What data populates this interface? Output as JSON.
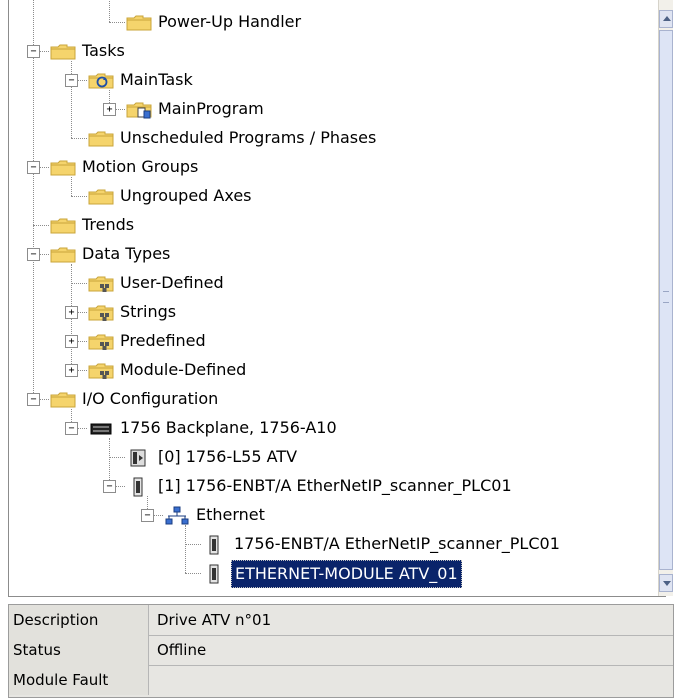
{
  "tree": {
    "items": [
      {
        "label": "Power-Up Handler"
      },
      {
        "label": "Tasks"
      },
      {
        "label": "MainTask"
      },
      {
        "label": "MainProgram"
      },
      {
        "label": "Unscheduled Programs / Phases"
      },
      {
        "label": "Motion Groups"
      },
      {
        "label": "Ungrouped Axes"
      },
      {
        "label": "Trends"
      },
      {
        "label": "Data Types"
      },
      {
        "label": "User-Defined"
      },
      {
        "label": "Strings"
      },
      {
        "label": "Predefined"
      },
      {
        "label": "Module-Defined"
      },
      {
        "label": "I/O Configuration"
      },
      {
        "label": "1756 Backplane, 1756-A10"
      },
      {
        "label": "[0] 1756-L55 ATV"
      },
      {
        "label": "[1] 1756-ENBT/A EtherNetIP_scanner_PLC01"
      },
      {
        "label": "Ethernet"
      },
      {
        "label": "1756-ENBT/A EtherNetIP_scanner_PLC01"
      },
      {
        "label": "ETHERNET-MODULE ATV_01"
      }
    ],
    "expander_symbols": {
      "expanded": "−",
      "collapsed": "+"
    }
  },
  "properties": {
    "rows": [
      {
        "key": "Description",
        "value": "Drive ATV n°01"
      },
      {
        "key": "Status",
        "value": "Offline"
      },
      {
        "key": "Module Fault",
        "value": ""
      }
    ]
  },
  "colors": {
    "selection": "#0a246a",
    "folder": "#f5d46c",
    "folder_dark": "#c9a43a"
  }
}
